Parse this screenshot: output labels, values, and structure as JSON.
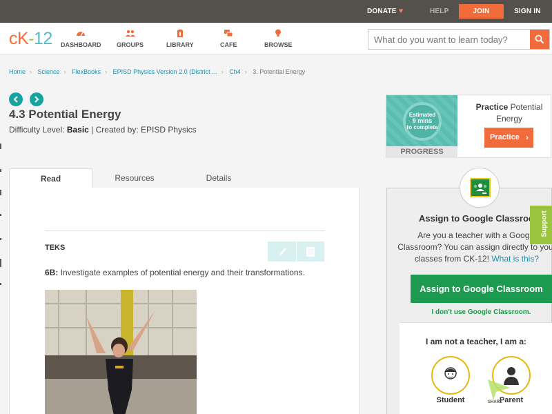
{
  "topbar": {
    "donate": "DONATE",
    "help": "HELP",
    "join": "JOIN",
    "sign_in": "SIGN IN"
  },
  "header": {
    "logo": {
      "ck": "cK",
      "dash": "-",
      "num": "12"
    },
    "nav": [
      {
        "label": "DASHBOARD",
        "icon": "dashboard-icon"
      },
      {
        "label": "GROUPS",
        "icon": "groups-icon"
      },
      {
        "label": "LIBRARY",
        "icon": "library-icon"
      },
      {
        "label": "CAFE",
        "icon": "cafe-icon"
      },
      {
        "label": "BROWSE",
        "icon": "lightbulb-icon"
      }
    ],
    "search": {
      "placeholder": "What do you want to learn today?"
    }
  },
  "breadcrumb": [
    "Home",
    "Science",
    "FlexBooks",
    "EPISD Physics Version 2.0 (District ...",
    "Ch4",
    "3. Potential Energy"
  ],
  "lesson": {
    "title": "4.3 Potential Energy",
    "difficulty_label": "Difficulty Level: ",
    "difficulty": "Basic",
    "created_by": " | Created by: EPISD Physics"
  },
  "tabs": [
    "Read",
    "Resources",
    "Details"
  ],
  "content": {
    "teks_heading": "TEKS",
    "teks_code": "6B:",
    "teks_text": " Investigate examples of potential energy and their transformations."
  },
  "practice": {
    "estimated": "Estimated",
    "mins": "9 mins",
    "to_complete": "to complete",
    "progress": "PROGRESS",
    "text_bold": "Practice",
    "text_rest": " Potential Energy",
    "button": "Practice"
  },
  "assign": {
    "title": "Assign to Google Classroom",
    "desc_line1": "Are you a teacher with a Google",
    "desc_line2": "Classroom? You can assign directly to your",
    "desc_line3": "classes from CK-12! ",
    "what_is_this": "What is this?",
    "button": "Assign to Google Classroom",
    "dont_use": "I don't use Google Classroom.",
    "not_teacher": "I am not a teacher, I am a:",
    "student": "Student",
    "parent": "Parent"
  },
  "support": "Support",
  "share": "SHARE",
  "colors": {
    "accent": "#f26b3a",
    "teal": "#17a3a0",
    "green": "#1c9a50",
    "topbar": "#54504b"
  }
}
